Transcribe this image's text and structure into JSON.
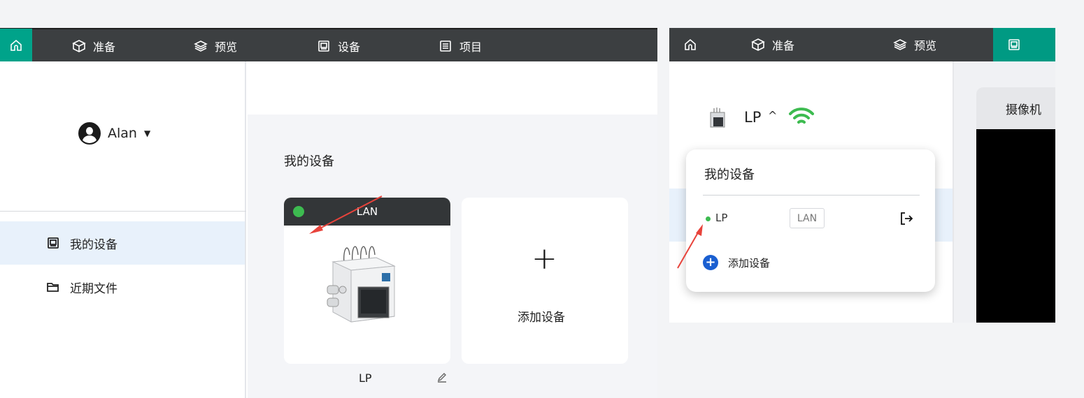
{
  "nav": {
    "prepare": "准备",
    "preview": "预览",
    "device": "设备",
    "project": "项目"
  },
  "sidebar": {
    "username": "Alan",
    "items": [
      {
        "label": "我的设备",
        "icon": "device-icon"
      },
      {
        "label": "近期文件",
        "icon": "folder-icon"
      }
    ]
  },
  "main": {
    "section_title": "我的设备",
    "device_card": {
      "connection": "LAN",
      "status_color": "#3dbb50",
      "name": "LP"
    },
    "add_card_label": "添加设备"
  },
  "right_panel": {
    "device_name": "LP",
    "camera_tab": "摄像机",
    "popup": {
      "title": "我的设备",
      "device_name": "LP",
      "connection_badge": "LAN",
      "add_label": "添加设备"
    }
  },
  "colors": {
    "topbar": "#3c3f41",
    "accent": "#00a38a",
    "online": "#3dbb50",
    "annotation_arrow": "#e8433b"
  }
}
